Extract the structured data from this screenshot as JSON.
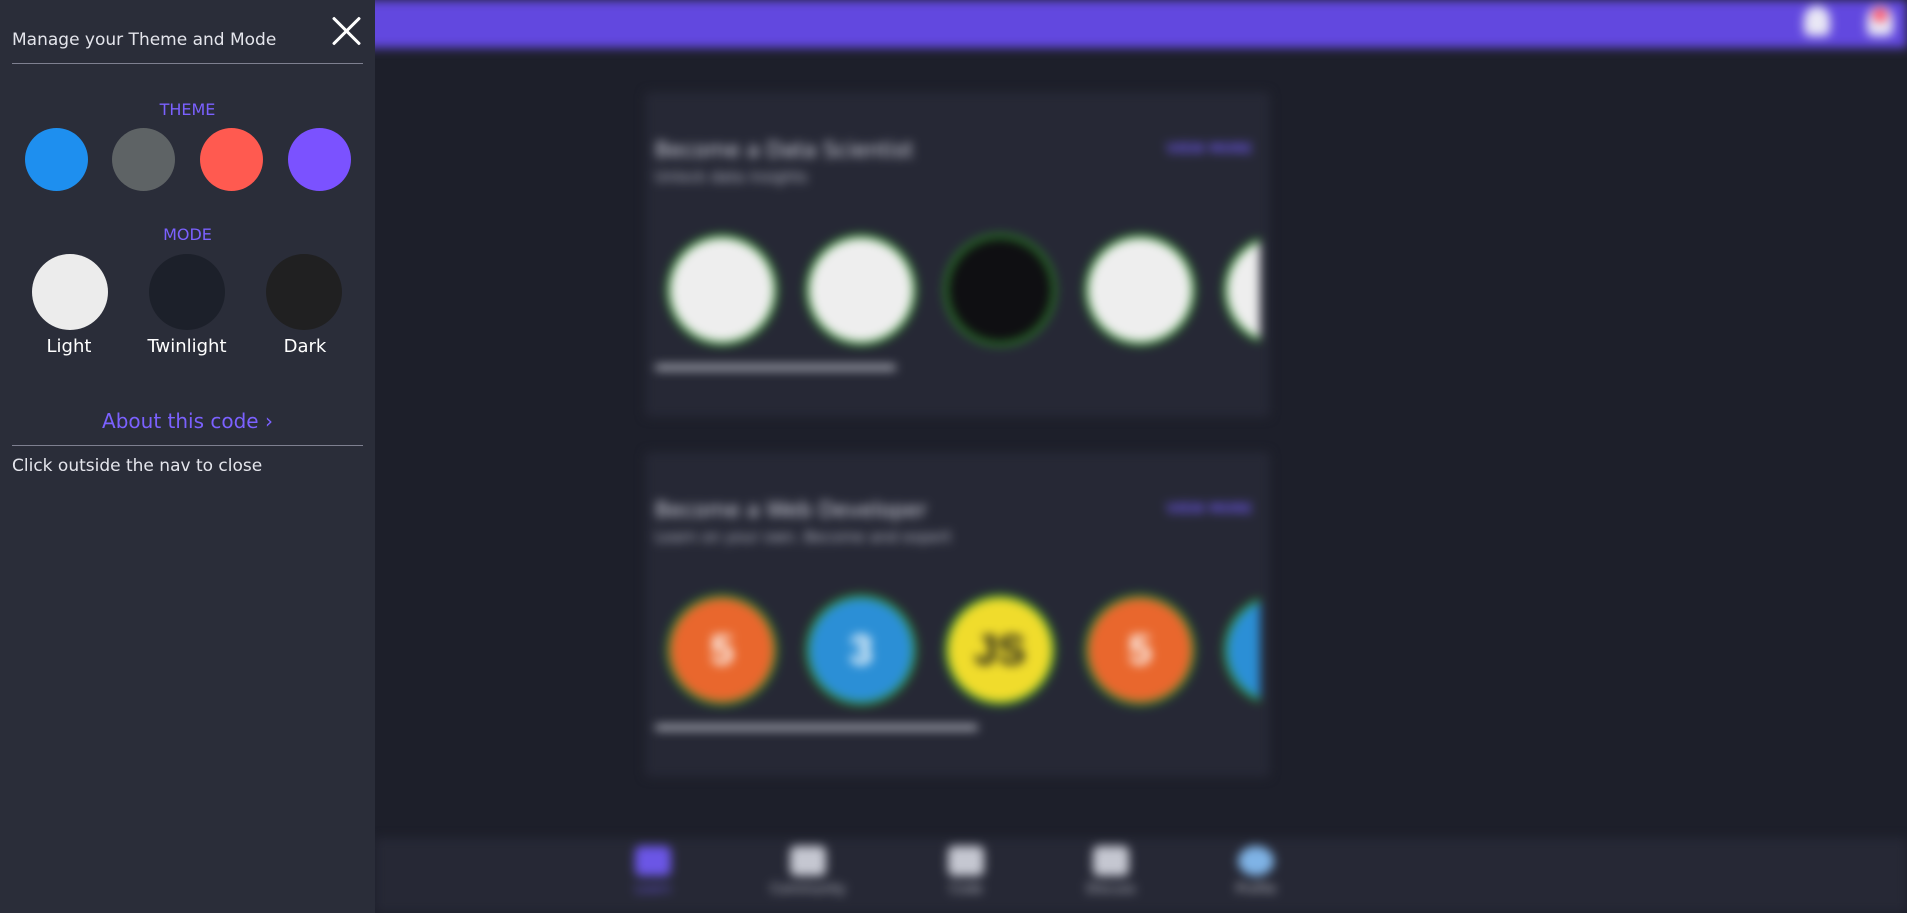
{
  "sidebar": {
    "title": "Manage your Theme and Mode",
    "theme_label": "THEME",
    "themes": [
      {
        "name": "blue",
        "color": "#1e8fef"
      },
      {
        "name": "gray",
        "color": "#5e6365"
      },
      {
        "name": "coral",
        "color": "#ff5a50"
      },
      {
        "name": "purple",
        "color": "#7b52ff"
      }
    ],
    "mode_label": "MODE",
    "modes": [
      {
        "label": "Light",
        "color": "#ececec"
      },
      {
        "label": "Twinlight",
        "color": "#1c202a"
      },
      {
        "label": "Dark",
        "color": "#202021"
      }
    ],
    "about_link": "About this code ›",
    "hint": "Click outside the nav to close"
  },
  "background": {
    "cards": [
      {
        "title": "Become a Data Scientist",
        "subtitle": "Unlock data insights",
        "view_more": "VIEW MORE",
        "courses": [
          {
            "name": "python-icon",
            "bg": "#eeeeee",
            "fg": "#3a6fb0",
            "glyph": ""
          },
          {
            "name": "data-icon",
            "bg": "#eeeeee",
            "fg": "#8fa6e8",
            "glyph": ""
          },
          {
            "name": "brain-icon",
            "bg": "#0f0f12",
            "fg": "#b0498f",
            "glyph": ""
          },
          {
            "name": "ml-icon",
            "bg": "#eeeeee",
            "fg": "#6b6bc4",
            "glyph": ""
          },
          {
            "name": "stats-icon",
            "bg": "#eeeeee",
            "fg": "#888888",
            "glyph": ""
          }
        ],
        "progress": 0.53
      },
      {
        "title": "Become a Web Developer",
        "subtitle": "Learn on your own. Become and expert",
        "view_more": "VIEW MORE",
        "courses": [
          {
            "name": "html5-icon",
            "bg": "#e9672d",
            "fg": "#ffffff",
            "glyph": "5"
          },
          {
            "name": "css3-icon",
            "bg": "#2b8fd6",
            "fg": "#ffffff",
            "glyph": "3"
          },
          {
            "name": "javascript-icon",
            "bg": "#f0dc2c",
            "fg": "#1a1a1a",
            "glyph": "JS"
          },
          {
            "name": "html5-icon",
            "bg": "#e9672d",
            "fg": "#ffffff",
            "glyph": "5"
          },
          {
            "name": "react-icon",
            "bg": "#2b8fd6",
            "fg": "#ffffff",
            "glyph": ""
          }
        ],
        "progress": 0.71
      }
    ],
    "bottom_nav": [
      {
        "label": "Learn",
        "active": true
      },
      {
        "label": "Community",
        "active": false
      },
      {
        "label": "Code",
        "active": false
      },
      {
        "label": "Discuss",
        "active": false
      },
      {
        "label": "Profile",
        "active": false
      }
    ]
  }
}
